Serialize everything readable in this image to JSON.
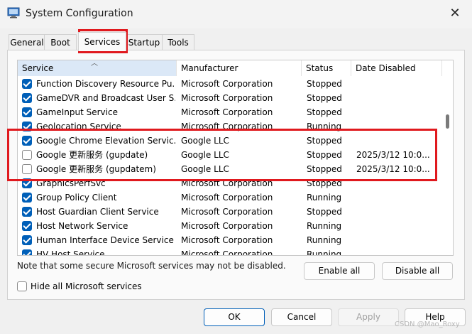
{
  "window": {
    "title": "System Configuration"
  },
  "tabs": [
    {
      "label": "General"
    },
    {
      "label": "Boot"
    },
    {
      "label": "Services",
      "active": true
    },
    {
      "label": "Startup"
    },
    {
      "label": "Tools"
    }
  ],
  "columns": [
    "Service",
    "Manufacturer",
    "Status",
    "Date Disabled"
  ],
  "rows": [
    {
      "checked": true,
      "service": "Function Discovery Resource Pu...",
      "manufacturer": "Microsoft Corporation",
      "status": "Stopped",
      "date": ""
    },
    {
      "checked": true,
      "service": "GameDVR and Broadcast User S...",
      "manufacturer": "Microsoft Corporation",
      "status": "Stopped",
      "date": ""
    },
    {
      "checked": true,
      "service": "GameInput Service",
      "manufacturer": "Microsoft Corporation",
      "status": "Stopped",
      "date": ""
    },
    {
      "checked": true,
      "service": "Geolocation Service",
      "manufacturer": "Microsoft Corporation",
      "status": "Running",
      "date": ""
    },
    {
      "checked": true,
      "service": "Google Chrome Elevation Servic...",
      "manufacturer": "Google LLC",
      "status": "Stopped",
      "date": ""
    },
    {
      "checked": false,
      "service": "Google 更新服务 (gupdate)",
      "manufacturer": "Google LLC",
      "status": "Stopped",
      "date": "2025/3/12 10:0..."
    },
    {
      "checked": false,
      "service": "Google 更新服务 (gupdatem)",
      "manufacturer": "Google LLC",
      "status": "Stopped",
      "date": "2025/3/12 10:0..."
    },
    {
      "checked": true,
      "service": "GraphicsPerfSvc",
      "manufacturer": "Microsoft Corporation",
      "status": "Stopped",
      "date": ""
    },
    {
      "checked": true,
      "service": "Group Policy Client",
      "manufacturer": "Microsoft Corporation",
      "status": "Running",
      "date": ""
    },
    {
      "checked": true,
      "service": "Host Guardian Client Service",
      "manufacturer": "Microsoft Corporation",
      "status": "Stopped",
      "date": ""
    },
    {
      "checked": true,
      "service": "Host Network Service",
      "manufacturer": "Microsoft Corporation",
      "status": "Running",
      "date": ""
    },
    {
      "checked": true,
      "service": "Human Interface Device Service",
      "manufacturer": "Microsoft Corporation",
      "status": "Running",
      "date": ""
    },
    {
      "checked": true,
      "service": "HV Host Service",
      "manufacturer": "Microsoft Corporation",
      "status": "Running",
      "date": ""
    }
  ],
  "note": "Note that some secure Microsoft services may not be disabled.",
  "buttons": {
    "enable_all": "Enable all",
    "disable_all": "Disable all",
    "ok": "OK",
    "cancel": "Cancel",
    "apply": "Apply",
    "help": "Help"
  },
  "hide_ms_label": "Hide all Microsoft services",
  "watermark": "CSDN @Mao_Roxy",
  "colors": {
    "accent": "#005fb8",
    "highlight": "#e0191e"
  }
}
